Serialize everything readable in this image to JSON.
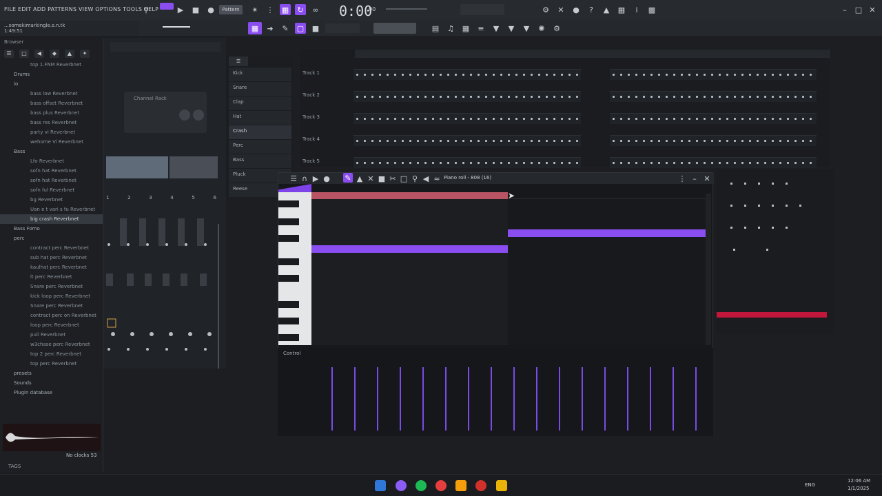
{
  "menubar": {
    "menu_text": "FILE EDIT ADD PATTERNS VIEW OPTIONS TOOLS HELP",
    "time": "0:00",
    "time_sub": "00",
    "pattern_label": "Pattern"
  },
  "hint": {
    "line1": "...somekimarkingle.s.n.tk",
    "line2": "1:49:51"
  },
  "browser": {
    "header": "Browser",
    "items": [
      {
        "label": "top 1.FNM Reverbnet",
        "sel": false,
        "folder": false
      },
      {
        "label": "Drums",
        "sel": false,
        "folder": true
      },
      {
        "label": "lo",
        "sel": false,
        "folder": true
      },
      {
        "label": "bass low Reverbnet",
        "sel": false,
        "folder": false
      },
      {
        "label": "bass offset Reverbnet",
        "sel": false,
        "folder": false
      },
      {
        "label": "bass plus Reverbnet",
        "sel": false,
        "folder": false
      },
      {
        "label": "bass res Reverbnet",
        "sel": false,
        "folder": false
      },
      {
        "label": "party vi Reverbnet",
        "sel": false,
        "folder": false
      },
      {
        "label": "wehome Vi Reverbnet",
        "sel": false,
        "folder": false
      },
      {
        "label": "Bass",
        "sel": false,
        "folder": true
      },
      {
        "label": "Lfo Reverbnet",
        "sel": false,
        "folder": false
      },
      {
        "label": "sofn hat Reverbnet",
        "sel": false,
        "folder": false
      },
      {
        "label": "sofn hat Reverbnet",
        "sel": false,
        "folder": false
      },
      {
        "label": "sofn ful Reverbnet",
        "sel": false,
        "folder": false
      },
      {
        "label": "bg Reverbnet",
        "sel": false,
        "folder": false
      },
      {
        "label": "Uan e t vari s fu Reverbnet",
        "sel": false,
        "folder": false
      },
      {
        "label": "big crash Reverbnet",
        "sel": true,
        "folder": false
      },
      {
        "label": "Bass Fomo",
        "sel": false,
        "folder": true
      },
      {
        "label": "perc",
        "sel": false,
        "folder": true
      },
      {
        "label": "contract perc Reverbnet",
        "sel": false,
        "folder": false
      },
      {
        "label": "sub hat perc Reverbnet",
        "sel": false,
        "folder": false
      },
      {
        "label": "kaulhat perc Reverbnet",
        "sel": false,
        "folder": false
      },
      {
        "label": "lt perc Reverbnet",
        "sel": false,
        "folder": false
      },
      {
        "label": "Snare perc Reverbnet",
        "sel": false,
        "folder": false
      },
      {
        "label": "kick loop perc Reverbnet",
        "sel": false,
        "folder": false
      },
      {
        "label": "Snare perc Reverbnet",
        "sel": false,
        "folder": false
      },
      {
        "label": "contract perc on Reverbnet",
        "sel": false,
        "folder": false
      },
      {
        "label": "loop perc Reverbnet",
        "sel": false,
        "folder": false
      },
      {
        "label": "pull Reverbnet",
        "sel": false,
        "folder": false
      },
      {
        "label": "w3chase perc Reverbnet",
        "sel": false,
        "folder": false
      },
      {
        "label": "top 2 perc Reverbnet",
        "sel": false,
        "folder": false
      },
      {
        "label": "top perc Reverbnet",
        "sel": false,
        "folder": false
      },
      {
        "label": "presets",
        "sel": false,
        "folder": true
      },
      {
        "label": "Sounds",
        "sel": false,
        "folder": true
      },
      {
        "label": "Plugin database",
        "sel": false,
        "folder": true
      }
    ],
    "footer_left": "TAGS",
    "footer_right": "No clocks 53"
  },
  "rack": {
    "plugin_title": "Channel Rack",
    "numbers": [
      "1",
      "2",
      "3",
      "4",
      "5",
      "6"
    ]
  },
  "channels": [
    {
      "label": "Kick",
      "sel": false
    },
    {
      "label": "Snare",
      "sel": false
    },
    {
      "label": "Clap",
      "sel": false
    },
    {
      "label": "Hat",
      "sel": false
    },
    {
      "label": "Crash",
      "sel": true
    },
    {
      "label": "Perc",
      "sel": false
    },
    {
      "label": "Bass",
      "sel": false
    },
    {
      "label": "Pluck",
      "sel": false
    },
    {
      "label": "Reese",
      "sel": false
    }
  ],
  "playlist": {
    "tracks": [
      "Track 1",
      "Track 2",
      "Track 3",
      "Track 4",
      "Track 5"
    ]
  },
  "pianoroll": {
    "title": "Piano roll - 808 (16)",
    "control_label": "Control"
  },
  "colors": {
    "accent": "#8a4df0",
    "note": "#8a4df0",
    "timeline": "#b85463",
    "red_clip": "#c0173b"
  },
  "taskbar": {
    "time": "12:06 AM",
    "date": "1/1/2025",
    "lang": "ENG"
  }
}
